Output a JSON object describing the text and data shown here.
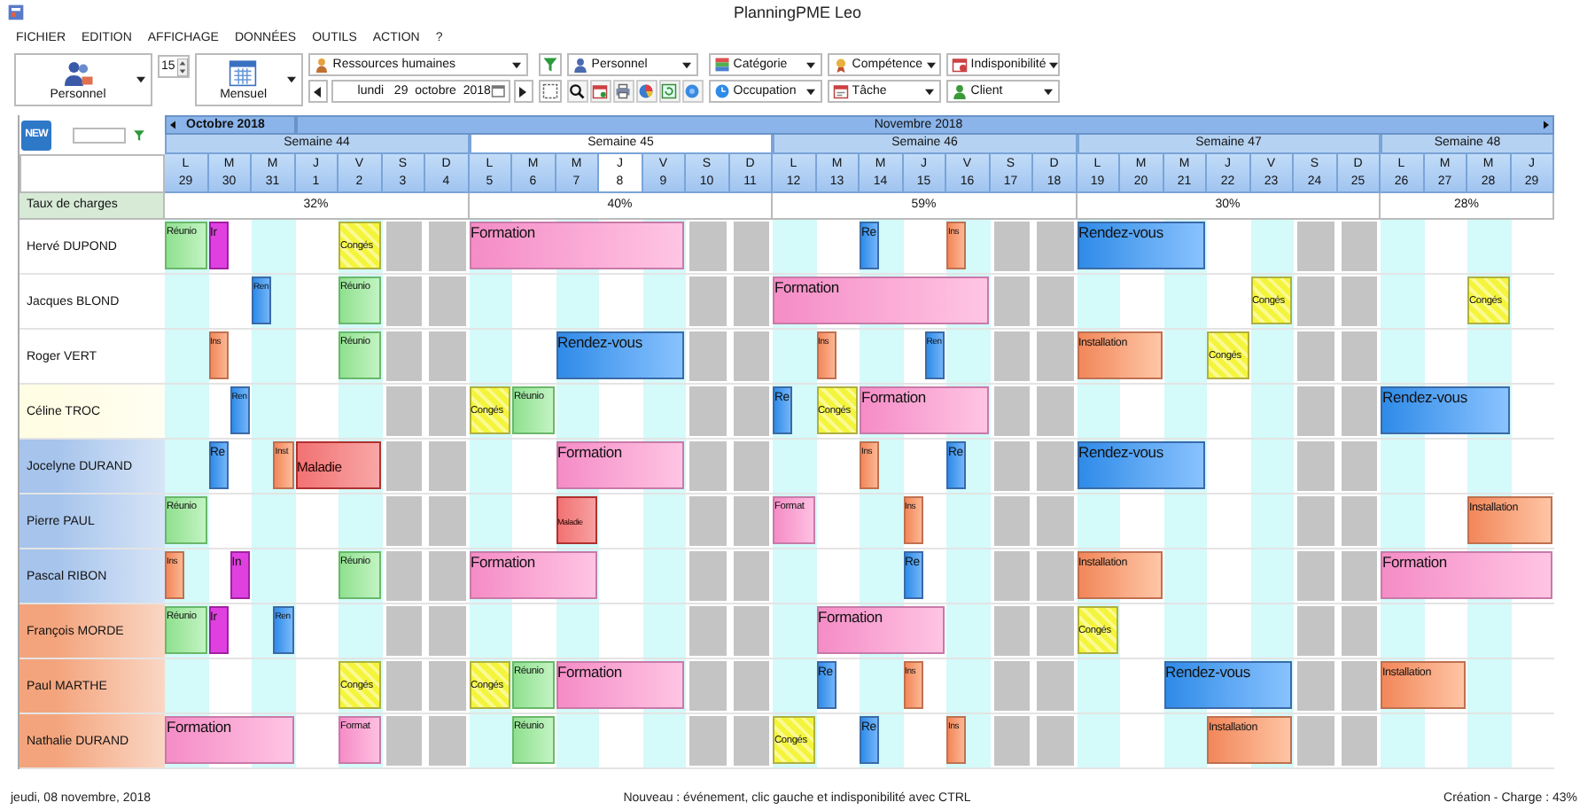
{
  "window": {
    "title": "PlanningPME Leo"
  },
  "menu": [
    "FICHIER",
    "EDITION",
    "AFFICHAGE",
    "DONNÉES",
    "OUTILS",
    "ACTION",
    "?"
  ],
  "toolbar": {
    "view_button": {
      "label": "Personnel"
    },
    "spinner": {
      "value": "15"
    },
    "period_button": {
      "label": "Mensuel"
    },
    "resource_combo": {
      "value": "Ressources humaines"
    },
    "date_field": {
      "value": "lundi   29  octobre  2018"
    },
    "filters_top": [
      {
        "kind": "person",
        "value": "Personnel"
      },
      {
        "kind": "category",
        "value": "Catégorie"
      },
      {
        "kind": "skill",
        "value": "Compétence"
      },
      {
        "kind": "unavailability",
        "value": "Indisponibilité"
      }
    ],
    "filters_bottom": [
      {
        "kind": "occupation",
        "value": "Occupation"
      },
      {
        "kind": "task",
        "value": "Tâche"
      },
      {
        "kind": "client",
        "value": "Client"
      }
    ]
  },
  "planning": {
    "new_button": "NEW",
    "charge_label": "Taux de charges",
    "months": [
      {
        "label": "Octobre 2018",
        "days": [
          {
            "letter": "L",
            "number": "29",
            "weekend": false,
            "selected": false
          },
          {
            "letter": "M",
            "number": "30",
            "weekend": false,
            "selected": false
          },
          {
            "letter": "M",
            "number": "31",
            "weekend": false,
            "selected": false
          }
        ]
      },
      {
        "label": "Novembre 2018",
        "days": [
          {
            "letter": "J",
            "number": "1",
            "weekend": false,
            "selected": false
          },
          {
            "letter": "V",
            "number": "2",
            "weekend": false,
            "selected": false
          },
          {
            "letter": "S",
            "number": "3",
            "weekend": true,
            "selected": false
          },
          {
            "letter": "D",
            "number": "4",
            "weekend": true,
            "selected": false
          },
          {
            "letter": "L",
            "number": "5",
            "weekend": false,
            "selected": false
          },
          {
            "letter": "M",
            "number": "6",
            "weekend": false,
            "selected": false
          },
          {
            "letter": "M",
            "number": "7",
            "weekend": false,
            "selected": false
          },
          {
            "letter": "J",
            "number": "8",
            "weekend": false,
            "selected": true
          },
          {
            "letter": "V",
            "number": "9",
            "weekend": false,
            "selected": false
          },
          {
            "letter": "S",
            "number": "10",
            "weekend": true,
            "selected": false
          },
          {
            "letter": "D",
            "number": "11",
            "weekend": true,
            "selected": false
          },
          {
            "letter": "L",
            "number": "12",
            "weekend": false,
            "selected": false
          },
          {
            "letter": "M",
            "number": "13",
            "weekend": false,
            "selected": false
          },
          {
            "letter": "M",
            "number": "14",
            "weekend": false,
            "selected": false
          },
          {
            "letter": "J",
            "number": "15",
            "weekend": false,
            "selected": false
          },
          {
            "letter": "V",
            "number": "16",
            "weekend": false,
            "selected": false
          },
          {
            "letter": "S",
            "number": "17",
            "weekend": true,
            "selected": false
          },
          {
            "letter": "D",
            "number": "18",
            "weekend": true,
            "selected": false
          },
          {
            "letter": "L",
            "number": "19",
            "weekend": false,
            "selected": false
          },
          {
            "letter": "M",
            "number": "20",
            "weekend": false,
            "selected": false
          },
          {
            "letter": "M",
            "number": "21",
            "weekend": false,
            "selected": false
          },
          {
            "letter": "J",
            "number": "22",
            "weekend": false,
            "selected": false
          },
          {
            "letter": "V",
            "number": "23",
            "weekend": false,
            "selected": false
          },
          {
            "letter": "S",
            "number": "24",
            "weekend": true,
            "selected": false
          },
          {
            "letter": "D",
            "number": "25",
            "weekend": true,
            "selected": false
          },
          {
            "letter": "L",
            "number": "26",
            "weekend": false,
            "selected": false
          },
          {
            "letter": "M",
            "number": "27",
            "weekend": false,
            "selected": false
          },
          {
            "letter": "M",
            "number": "28",
            "weekend": false,
            "selected": false
          },
          {
            "letter": "J",
            "number": "29",
            "weekend": false,
            "selected": false
          }
        ]
      }
    ],
    "weeks": [
      {
        "label": "Semaine 44",
        "charge": "32%",
        "selected": false
      },
      {
        "label": "Semaine 45",
        "charge": "40%",
        "selected": true
      },
      {
        "label": "Semaine 46",
        "charge": "59%",
        "selected": false
      },
      {
        "label": "Semaine 47",
        "charge": "30%",
        "selected": false
      },
      {
        "label": "Semaine 48",
        "charge": "28%",
        "selected": false
      }
    ],
    "rows": [
      {
        "name": "Hervé DUPOND",
        "color": "#ffffff",
        "cells": [
          {
            "kind": "reunion",
            "label": "Réunio",
            "am": true,
            "pm": true,
            "continued": false
          },
          {
            "kind": "other",
            "label": "Ir",
            "am": true,
            "pm": false,
            "continued": false
          },
          {
            "kind": "free"
          },
          {
            "kind": "free"
          },
          {
            "kind": "conges",
            "label": "Congés",
            "am": true,
            "pm": true,
            "continued": false
          },
          {
            "kind": "free"
          },
          {
            "kind": "free"
          },
          {
            "kind": "formation",
            "label": "Formation",
            "am": true,
            "pm": true,
            "continued": false
          },
          {
            "kind": "formation",
            "am": true,
            "pm": true,
            "continued": true
          },
          {
            "kind": "formation",
            "am": true,
            "pm": true,
            "continued": true
          },
          {
            "kind": "formation",
            "am": true,
            "pm": true,
            "continued": true
          },
          {
            "kind": "formation",
            "am": true,
            "pm": true,
            "continued": true
          },
          {
            "kind": "free"
          },
          {
            "kind": "free"
          },
          {
            "kind": "free"
          },
          {
            "kind": "free"
          },
          {
            "kind": "rendezvous",
            "label": "Re",
            "am": true,
            "pm": false,
            "continued": false
          },
          {
            "kind": "free"
          },
          {
            "kind": "installation",
            "label": "Ins",
            "am": true,
            "pm": false,
            "continued": false
          },
          {
            "kind": "free"
          },
          {
            "kind": "free"
          },
          {
            "kind": "rendezvous",
            "label": "Rendez-vous",
            "am": true,
            "pm": true,
            "continued": false
          },
          {
            "kind": "rendezvous",
            "am": true,
            "pm": true,
            "continued": true
          },
          {
            "kind": "rendezvous",
            "am": true,
            "pm": true,
            "continued": true
          },
          {
            "kind": "free"
          },
          {
            "kind": "free"
          },
          {
            "kind": "free"
          },
          {
            "kind": "free"
          },
          {
            "kind": "free"
          },
          {
            "kind": "free"
          },
          {
            "kind": "free"
          },
          {
            "kind": "free"
          }
        ]
      },
      {
        "name": "Jacques BLOND",
        "color": "#ffffff",
        "cells": [
          {
            "kind": "free"
          },
          {
            "kind": "free"
          },
          {
            "kind": "rendezvous",
            "label": "Ren",
            "am": true,
            "pm": false,
            "continued": false
          },
          {
            "kind": "free"
          },
          {
            "kind": "reunion",
            "label": "Réunio",
            "am": true,
            "pm": true,
            "continued": false
          },
          {
            "kind": "free"
          },
          {
            "kind": "free"
          },
          {
            "kind": "free"
          },
          {
            "kind": "free"
          },
          {
            "kind": "free"
          },
          {
            "kind": "free"
          },
          {
            "kind": "free"
          },
          {
            "kind": "free"
          },
          {
            "kind": "free"
          },
          {
            "kind": "formation",
            "label": "Formation",
            "am": true,
            "pm": true,
            "continued": false
          },
          {
            "kind": "formation",
            "am": true,
            "pm": true,
            "continued": true
          },
          {
            "kind": "formation",
            "am": true,
            "pm": true,
            "continued": true
          },
          {
            "kind": "formation",
            "am": true,
            "pm": true,
            "continued": true
          },
          {
            "kind": "formation",
            "am": true,
            "pm": true,
            "continued": true
          },
          {
            "kind": "free"
          },
          {
            "kind": "free"
          },
          {
            "kind": "free"
          },
          {
            "kind": "free"
          },
          {
            "kind": "free"
          },
          {
            "kind": "free"
          },
          {
            "kind": "conges",
            "label": "Congés",
            "am": true,
            "pm": true,
            "continued": false
          },
          {
            "kind": "free"
          },
          {
            "kind": "free"
          },
          {
            "kind": "free"
          },
          {
            "kind": "free"
          },
          {
            "kind": "conges",
            "label": "Congés",
            "am": true,
            "pm": true,
            "continued": false
          },
          {
            "kind": "free"
          }
        ]
      },
      {
        "name": "Roger VERT",
        "color": "#ffffff",
        "cells": [
          {
            "kind": "free"
          },
          {
            "kind": "installation",
            "label": "Ins",
            "am": true,
            "pm": false,
            "continued": false
          },
          {
            "kind": "free"
          },
          {
            "kind": "free"
          },
          {
            "kind": "reunion",
            "label": "Réunio",
            "am": true,
            "pm": true,
            "continued": false
          },
          {
            "kind": "free"
          },
          {
            "kind": "free"
          },
          {
            "kind": "free"
          },
          {
            "kind": "free"
          },
          {
            "kind": "rendezvous",
            "label": "Rendez-vous",
            "am": true,
            "pm": true,
            "continued": false
          },
          {
            "kind": "rendezvous",
            "am": true,
            "pm": true,
            "continued": true
          },
          {
            "kind": "rendezvous",
            "am": true,
            "pm": true,
            "continued": true
          },
          {
            "kind": "free"
          },
          {
            "kind": "free"
          },
          {
            "kind": "free"
          },
          {
            "kind": "installation",
            "label": "Ins",
            "am": true,
            "pm": false,
            "continued": false
          },
          {
            "kind": "free"
          },
          {
            "kind": "rendezvous",
            "label": "Ren",
            "am": false,
            "pm": true,
            "continued": false
          },
          {
            "kind": "free"
          },
          {
            "kind": "free"
          },
          {
            "kind": "free"
          },
          {
            "kind": "installation",
            "label": "Installation",
            "am": true,
            "pm": true,
            "continued": false
          },
          {
            "kind": "installation",
            "am": true,
            "pm": true,
            "continued": true
          },
          {
            "kind": "free"
          },
          {
            "kind": "conges",
            "label": "Congés",
            "am": true,
            "pm": true,
            "continued": false
          },
          {
            "kind": "free"
          },
          {
            "kind": "free"
          },
          {
            "kind": "free"
          },
          {
            "kind": "free"
          },
          {
            "kind": "free"
          },
          {
            "kind": "free"
          },
          {
            "kind": "free"
          }
        ]
      },
      {
        "name": "Céline TROC",
        "color": "#fffde4",
        "cells": [
          {
            "kind": "free"
          },
          {
            "kind": "rendezvous",
            "label": "Ren",
            "am": false,
            "pm": true,
            "continued": false
          },
          {
            "kind": "free"
          },
          {
            "kind": "free"
          },
          {
            "kind": "free"
          },
          {
            "kind": "free"
          },
          {
            "kind": "free"
          },
          {
            "kind": "conges",
            "label": "Congés",
            "am": true,
            "pm": true,
            "continued": false
          },
          {
            "kind": "reunion",
            "label": "Réunio",
            "am": true,
            "pm": true,
            "continued": false
          },
          {
            "kind": "free"
          },
          {
            "kind": "free"
          },
          {
            "kind": "free"
          },
          {
            "kind": "free"
          },
          {
            "kind": "free"
          },
          {
            "kind": "rendezvous",
            "label": "Re",
            "am": true,
            "pm": false,
            "continued": false
          },
          {
            "kind": "conges",
            "label": "Congés",
            "am": true,
            "pm": true,
            "continued": false
          },
          {
            "kind": "formation",
            "label": "Formation",
            "am": true,
            "pm": true,
            "continued": false
          },
          {
            "kind": "formation",
            "am": true,
            "pm": true,
            "continued": true
          },
          {
            "kind": "formation",
            "am": true,
            "pm": true,
            "continued": true
          },
          {
            "kind": "free"
          },
          {
            "kind": "free"
          },
          {
            "kind": "free"
          },
          {
            "kind": "free"
          },
          {
            "kind": "free"
          },
          {
            "kind": "free"
          },
          {
            "kind": "free"
          },
          {
            "kind": "free"
          },
          {
            "kind": "free"
          },
          {
            "kind": "rendezvous",
            "label": "Rendez-vous",
            "am": true,
            "pm": true,
            "continued": false
          },
          {
            "kind": "rendezvous",
            "am": true,
            "pm": true,
            "continued": true
          },
          {
            "kind": "rendezvous",
            "am": true,
            "pm": true,
            "continued": true
          },
          {
            "kind": "free"
          }
        ]
      },
      {
        "name": "Jocelyne DURAND",
        "color": "#a6c4ec",
        "cells": [
          {
            "kind": "free"
          },
          {
            "kind": "rendezvous",
            "label": "Re",
            "am": true,
            "pm": false,
            "continued": false
          },
          {
            "kind": "installation",
            "label": "Inst",
            "am": false,
            "pm": true,
            "continued": false
          },
          {
            "kind": "maladie",
            "label": "Maladie",
            "am": true,
            "pm": true,
            "continued": false
          },
          {
            "kind": "maladie",
            "am": true,
            "pm": true,
            "continued": true
          },
          {
            "kind": "free"
          },
          {
            "kind": "free"
          },
          {
            "kind": "free"
          },
          {
            "kind": "free"
          },
          {
            "kind": "formation",
            "label": "Formation",
            "am": true,
            "pm": true,
            "continued": false
          },
          {
            "kind": "formation",
            "am": true,
            "pm": true,
            "continued": true
          },
          {
            "kind": "formation",
            "am": true,
            "pm": true,
            "continued": true
          },
          {
            "kind": "free"
          },
          {
            "kind": "free"
          },
          {
            "kind": "free"
          },
          {
            "kind": "free"
          },
          {
            "kind": "installation",
            "label": "Ins",
            "am": true,
            "pm": false,
            "continued": false
          },
          {
            "kind": "free"
          },
          {
            "kind": "rendezvous",
            "label": "Re",
            "am": true,
            "pm": false,
            "continued": false
          },
          {
            "kind": "free"
          },
          {
            "kind": "free"
          },
          {
            "kind": "rendezvous",
            "label": "Rendez-vous",
            "am": true,
            "pm": true,
            "continued": false
          },
          {
            "kind": "rendezvous",
            "am": true,
            "pm": true,
            "continued": true
          },
          {
            "kind": "rendezvous",
            "am": true,
            "pm": true,
            "continued": true
          },
          {
            "kind": "free"
          },
          {
            "kind": "free"
          },
          {
            "kind": "free"
          },
          {
            "kind": "free"
          },
          {
            "kind": "free"
          },
          {
            "kind": "free"
          },
          {
            "kind": "free"
          },
          {
            "kind": "free"
          }
        ]
      },
      {
        "name": "Pierre PAUL",
        "color": "#a6c4ec",
        "cells": [
          {
            "kind": "reunion",
            "label": "Réunio",
            "am": true,
            "pm": true,
            "continued": false
          },
          {
            "kind": "free"
          },
          {
            "kind": "free"
          },
          {
            "kind": "free"
          },
          {
            "kind": "free"
          },
          {
            "kind": "free"
          },
          {
            "kind": "free"
          },
          {
            "kind": "free"
          },
          {
            "kind": "free"
          },
          {
            "kind": "maladie",
            "label": "Maladie",
            "am": true,
            "pm": true,
            "continued": false
          },
          {
            "kind": "free"
          },
          {
            "kind": "free"
          },
          {
            "kind": "free"
          },
          {
            "kind": "free"
          },
          {
            "kind": "formation",
            "label": "Format",
            "am": true,
            "pm": true,
            "continued": false
          },
          {
            "kind": "free"
          },
          {
            "kind": "free"
          },
          {
            "kind": "installation",
            "label": "Ins",
            "am": true,
            "pm": false,
            "continued": false
          },
          {
            "kind": "free"
          },
          {
            "kind": "free"
          },
          {
            "kind": "free"
          },
          {
            "kind": "free"
          },
          {
            "kind": "free"
          },
          {
            "kind": "free"
          },
          {
            "kind": "free"
          },
          {
            "kind": "free"
          },
          {
            "kind": "free"
          },
          {
            "kind": "free"
          },
          {
            "kind": "free"
          },
          {
            "kind": "free"
          },
          {
            "kind": "installation",
            "label": "Installation",
            "am": true,
            "pm": true,
            "continued": false
          },
          {
            "kind": "installation",
            "am": true,
            "pm": true,
            "continued": true
          }
        ]
      },
      {
        "name": "Pascal RIBON",
        "color": "#a6c4ec",
        "cells": [
          {
            "kind": "installation",
            "label": "Ins",
            "am": true,
            "pm": false,
            "continued": false
          },
          {
            "kind": "other",
            "label": "In",
            "am": false,
            "pm": true,
            "continued": false
          },
          {
            "kind": "free"
          },
          {
            "kind": "free"
          },
          {
            "kind": "reunion",
            "label": "Réunio",
            "am": true,
            "pm": true,
            "continued": false
          },
          {
            "kind": "free"
          },
          {
            "kind": "free"
          },
          {
            "kind": "formation",
            "label": "Formation",
            "am": true,
            "pm": true,
            "continued": false
          },
          {
            "kind": "formation",
            "am": true,
            "pm": true,
            "continued": true
          },
          {
            "kind": "formation",
            "am": true,
            "pm": true,
            "continued": true
          },
          {
            "kind": "free"
          },
          {
            "kind": "free"
          },
          {
            "kind": "free"
          },
          {
            "kind": "free"
          },
          {
            "kind": "free"
          },
          {
            "kind": "free"
          },
          {
            "kind": "free"
          },
          {
            "kind": "rendezvous",
            "label": "Re",
            "am": true,
            "pm": false,
            "continued": false
          },
          {
            "kind": "free"
          },
          {
            "kind": "free"
          },
          {
            "kind": "free"
          },
          {
            "kind": "installation",
            "label": "Installation",
            "am": true,
            "pm": true,
            "continued": false
          },
          {
            "kind": "installation",
            "am": true,
            "pm": true,
            "continued": true
          },
          {
            "kind": "free"
          },
          {
            "kind": "free"
          },
          {
            "kind": "free"
          },
          {
            "kind": "free"
          },
          {
            "kind": "free"
          },
          {
            "kind": "formation",
            "label": "Formation",
            "am": true,
            "pm": true,
            "continued": false
          },
          {
            "kind": "formation",
            "am": true,
            "pm": true,
            "continued": true
          },
          {
            "kind": "formation",
            "am": true,
            "pm": true,
            "continued": true
          },
          {
            "kind": "formation",
            "am": true,
            "pm": true,
            "continued": true
          }
        ]
      },
      {
        "name": "François MORDE",
        "color": "#f3a47c",
        "cells": [
          {
            "kind": "reunion",
            "label": "Réunio",
            "am": true,
            "pm": true,
            "continued": false
          },
          {
            "kind": "other",
            "label": "Ir",
            "am": true,
            "pm": false,
            "continued": false
          },
          {
            "kind": "rendezvous",
            "label": "Ren",
            "am": false,
            "pm": true,
            "continued": false
          },
          {
            "kind": "free"
          },
          {
            "kind": "free"
          },
          {
            "kind": "free"
          },
          {
            "kind": "free"
          },
          {
            "kind": "free"
          },
          {
            "kind": "free"
          },
          {
            "kind": "free"
          },
          {
            "kind": "free"
          },
          {
            "kind": "free"
          },
          {
            "kind": "free"
          },
          {
            "kind": "free"
          },
          {
            "kind": "free"
          },
          {
            "kind": "formation",
            "label": "Formation",
            "am": true,
            "pm": true,
            "continued": false
          },
          {
            "kind": "formation",
            "am": true,
            "pm": true,
            "continued": true
          },
          {
            "kind": "formation",
            "am": true,
            "pm": true,
            "continued": true
          },
          {
            "kind": "free"
          },
          {
            "kind": "free"
          },
          {
            "kind": "free"
          },
          {
            "kind": "conges",
            "label": "Congés",
            "am": true,
            "pm": true,
            "continued": false
          },
          {
            "kind": "free"
          },
          {
            "kind": "free"
          },
          {
            "kind": "free"
          },
          {
            "kind": "free"
          },
          {
            "kind": "free"
          },
          {
            "kind": "free"
          },
          {
            "kind": "free"
          },
          {
            "kind": "free"
          },
          {
            "kind": "free"
          },
          {
            "kind": "free"
          }
        ]
      },
      {
        "name": "Paul MARTHE",
        "color": "#f3a47c",
        "cells": [
          {
            "kind": "free"
          },
          {
            "kind": "free"
          },
          {
            "kind": "free"
          },
          {
            "kind": "free"
          },
          {
            "kind": "conges",
            "label": "Congés",
            "am": true,
            "pm": true,
            "continued": false
          },
          {
            "kind": "free"
          },
          {
            "kind": "free"
          },
          {
            "kind": "conges",
            "label": "Congés",
            "am": true,
            "pm": true,
            "continued": false
          },
          {
            "kind": "reunion",
            "label": "Réunio",
            "am": true,
            "pm": true,
            "continued": false
          },
          {
            "kind": "formation",
            "label": "Formation",
            "am": true,
            "pm": true,
            "continued": false
          },
          {
            "kind": "formation",
            "am": true,
            "pm": true,
            "continued": true
          },
          {
            "kind": "formation",
            "am": true,
            "pm": true,
            "continued": true
          },
          {
            "kind": "free"
          },
          {
            "kind": "free"
          },
          {
            "kind": "free"
          },
          {
            "kind": "rendezvous",
            "label": "Re",
            "am": true,
            "pm": false,
            "continued": false
          },
          {
            "kind": "free"
          },
          {
            "kind": "installation",
            "label": "Ins",
            "am": true,
            "pm": false,
            "continued": false
          },
          {
            "kind": "free"
          },
          {
            "kind": "free"
          },
          {
            "kind": "free"
          },
          {
            "kind": "free"
          },
          {
            "kind": "free"
          },
          {
            "kind": "rendezvous",
            "label": "Rendez-vous",
            "am": true,
            "pm": true,
            "continued": false
          },
          {
            "kind": "rendezvous",
            "am": true,
            "pm": true,
            "continued": true
          },
          {
            "kind": "rendezvous",
            "am": true,
            "pm": true,
            "continued": true
          },
          {
            "kind": "free"
          },
          {
            "kind": "free"
          },
          {
            "kind": "installation",
            "label": "Installation",
            "am": true,
            "pm": true,
            "continued": false
          },
          {
            "kind": "installation",
            "am": true,
            "pm": true,
            "continued": true
          },
          {
            "kind": "free"
          },
          {
            "kind": "free"
          }
        ]
      },
      {
        "name": "Nathalie DURAND",
        "color": "#f3a47c",
        "cells": [
          {
            "kind": "formation",
            "label": "Formation",
            "am": true,
            "pm": true,
            "continued": false
          },
          {
            "kind": "formation",
            "am": true,
            "pm": true,
            "continued": true
          },
          {
            "kind": "formation",
            "am": true,
            "pm": true,
            "continued": true
          },
          {
            "kind": "free"
          },
          {
            "kind": "formation",
            "label": "Format",
            "am": true,
            "pm": true,
            "continued": false
          },
          {
            "kind": "free"
          },
          {
            "kind": "free"
          },
          {
            "kind": "free"
          },
          {
            "kind": "reunion",
            "label": "Réunio",
            "am": true,
            "pm": true,
            "continued": false
          },
          {
            "kind": "free"
          },
          {
            "kind": "free"
          },
          {
            "kind": "free"
          },
          {
            "kind": "free"
          },
          {
            "kind": "free"
          },
          {
            "kind": "conges",
            "label": "Congés",
            "am": true,
            "pm": true,
            "continued": false
          },
          {
            "kind": "free"
          },
          {
            "kind": "rendezvous",
            "label": "Re",
            "am": true,
            "pm": false,
            "continued": false
          },
          {
            "kind": "free"
          },
          {
            "kind": "installation",
            "label": "Ins",
            "am": true,
            "pm": false,
            "continued": false
          },
          {
            "kind": "free"
          },
          {
            "kind": "free"
          },
          {
            "kind": "free"
          },
          {
            "kind": "free"
          },
          {
            "kind": "free"
          },
          {
            "kind": "installation",
            "label": "Installation",
            "am": true,
            "pm": true,
            "continued": false
          },
          {
            "kind": "installation",
            "am": true,
            "pm": true,
            "continued": true
          },
          {
            "kind": "free"
          },
          {
            "kind": "free"
          },
          {
            "kind": "free"
          },
          {
            "kind": "free"
          },
          {
            "kind": "free"
          },
          {
            "kind": "free"
          }
        ]
      }
    ]
  },
  "status_bar": {
    "date": "jeudi, 08 novembre, 2018",
    "hint": "Nouveau : événement, clic gauche et indisponibilité avec CTRL",
    "charge": "Création - Charge : 43%"
  }
}
